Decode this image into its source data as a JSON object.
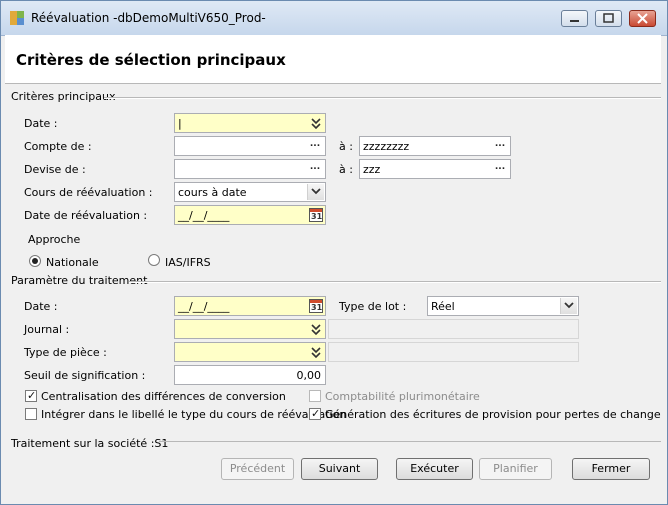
{
  "window": {
    "title": "Réévaluation -dbDemoMultiV650_Prod-",
    "colors": {
      "required_field": "#ffffc8",
      "titlebar": "#dfe9f5",
      "close": "#c94a33"
    }
  },
  "header": {
    "title": "Critères de sélection principaux"
  },
  "criteria": {
    "group_label": "Critères principaux",
    "date": {
      "label": "Date :",
      "value": "|"
    },
    "account": {
      "label": "Compte de :",
      "from_value": "",
      "to_label": "à :",
      "to_value": "zzzzzzzz"
    },
    "currency": {
      "label": "Devise de :",
      "from_value": "",
      "to_label": "à :",
      "to_value": "zzz"
    },
    "rate": {
      "label": "Cours de réévaluation  :",
      "value": "cours à date"
    },
    "reval_date": {
      "label": "Date de réévaluation :",
      "value": "__/__/____"
    },
    "approach": {
      "label": "Approche",
      "options": [
        {
          "label": "Nationale",
          "selected": true
        },
        {
          "label": "IAS/IFRS",
          "selected": false
        }
      ]
    }
  },
  "processing": {
    "group_label": "Paramètre du traitement",
    "date": {
      "label": "Date :",
      "value": "__/__/____"
    },
    "batch_type": {
      "label": "Type de lot :",
      "value": "Réel"
    },
    "journal": {
      "label": "Journal :",
      "value": ""
    },
    "doc_type": {
      "label": "Type de pièce :",
      "value": ""
    },
    "threshold": {
      "label": "Seuil de signification :",
      "value": "0,00"
    },
    "checks": {
      "centralisation": {
        "label": "Centralisation des différences de conversion",
        "checked": true
      },
      "multicurrency": {
        "label": "Comptabilité plurimonétaire",
        "checked": false,
        "disabled": true
      },
      "label_rate_type": {
        "label": "Intégrer dans le libellé le type du cours de réévaluation",
        "checked": false
      },
      "provision": {
        "label": "Génération des écritures de provision pour pertes de change",
        "checked": true
      }
    }
  },
  "footer": {
    "company_label": "Traitement sur la société :S1",
    "buttons": {
      "previous": "Précédent",
      "next": "Suivant",
      "execute": "Exécuter",
      "plan": "Planifier",
      "close": "Fermer"
    }
  },
  "icons": {
    "ellipsis": "...",
    "calendar": "31",
    "check": "✓",
    "double_chevron": "double-chevron-down-icon"
  }
}
